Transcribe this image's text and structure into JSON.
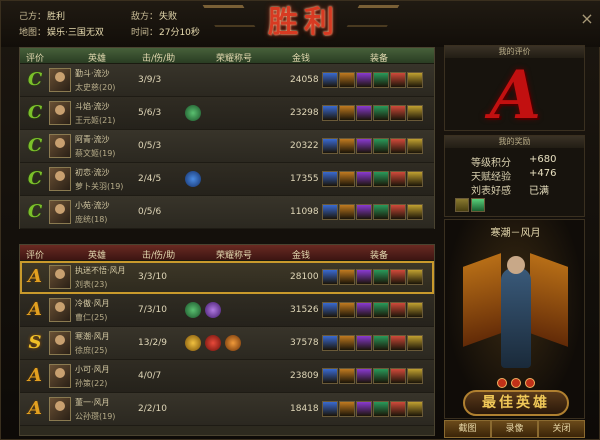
{
  "header": {
    "our_side_label": "己方：",
    "our_side_value": "胜利",
    "enemy_side_label": "敌方：",
    "enemy_side_value": "失败",
    "map_label": "地图：",
    "map_value": "娱乐·三国无双",
    "time_label": "时间：",
    "time_value": "27分10秒",
    "result_banner": "胜利",
    "close_icon": "×"
  },
  "columns": {
    "rank": "评价",
    "hero": "英雄",
    "kda": "击/伤/助",
    "honor": "荣耀称号",
    "gold": "金钱",
    "equip": "装备"
  },
  "winners": [
    {
      "grade": "C",
      "player": "勤斗·流沙",
      "hero": "太史慈(20)",
      "kda": "3/9/3",
      "honors": [],
      "gold": "24058"
    },
    {
      "grade": "C",
      "player": "斗焰·流沙",
      "hero": "王元姬(21)",
      "kda": "5/6/3",
      "honors": [
        "green-seal"
      ],
      "gold": "23298"
    },
    {
      "grade": "C",
      "player": "阿青·流沙",
      "hero": "蔡文姬(19)",
      "kda": "0/5/3",
      "honors": [],
      "gold": "20322"
    },
    {
      "grade": "C",
      "player": "初恋·流沙",
      "hero": "萝卜关羽(19)",
      "kda": "2/4/5",
      "honors": [
        "blue-seal"
      ],
      "gold": "17355"
    },
    {
      "grade": "C",
      "player": "小苑·流沙",
      "hero": "庞统(18)",
      "kda": "0/5/6",
      "honors": [],
      "gold": "11098"
    }
  ],
  "losers": [
    {
      "grade": "A",
      "player": "执迷不悟·风月",
      "hero": "刘表(23)",
      "kda": "3/3/10",
      "honors": [],
      "gold": "28100",
      "highlight": true
    },
    {
      "grade": "A",
      "player": "冷傲·风月",
      "hero": "曹仁(25)",
      "kda": "7/3/10",
      "honors": [
        "green-seal",
        "purple-seal"
      ],
      "gold": "31526"
    },
    {
      "grade": "S",
      "player": "寒潮·风月",
      "hero": "徐庶(25)",
      "kda": "13/2/9",
      "honors": [
        "gold-seal",
        "red-seal",
        "orange-seal"
      ],
      "gold": "37578"
    },
    {
      "grade": "A",
      "player": "小可·风月",
      "hero": "孙策(22)",
      "kda": "4/0/7",
      "honors": [],
      "gold": "23809"
    },
    {
      "grade": "A",
      "player": "董一·风月",
      "hero": "公孙瓒(19)",
      "kda": "2/2/10",
      "honors": [],
      "gold": "18418"
    }
  ],
  "my_evaluation": {
    "title": "我的评价",
    "grade": "A"
  },
  "my_rewards": {
    "title": "我的奖励",
    "items": [
      {
        "label": "等级积分",
        "value": "+680"
      },
      {
        "label": "天赋经验",
        "value": "+476"
      },
      {
        "label": "刘表好感",
        "value": "已满"
      }
    ],
    "reward_icons": [
      "leaf-bundle-icon",
      "green-gem-icon"
    ]
  },
  "best_hero": {
    "player": "寒潮－风月",
    "button_label": "最佳英雄"
  },
  "bottom_buttons": [
    "截图",
    "录像",
    "关闭"
  ],
  "colors": {
    "win_header": "#2a3d23",
    "lose_header": "#3c1512",
    "grade_c": "#7bc02a",
    "grade_a": "#e2a020",
    "grade_s": "#f0c028",
    "my_grade": "#c21010",
    "highlight_border": "#c99a2c"
  }
}
